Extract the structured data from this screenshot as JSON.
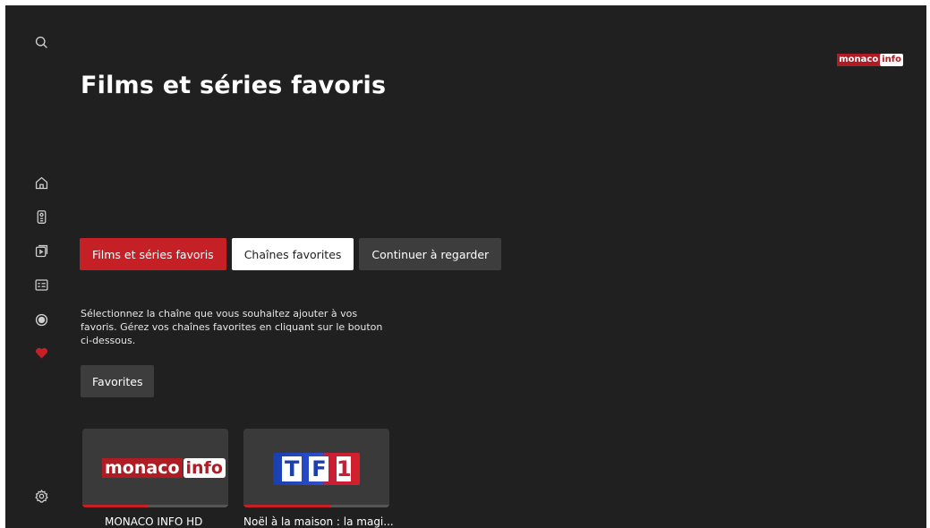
{
  "brand": {
    "logo_left": "monaco",
    "logo_right": "info"
  },
  "sidebar": {
    "items": [
      {
        "icon": "search-icon"
      },
      {
        "icon": "home-icon"
      },
      {
        "icon": "remote-icon"
      },
      {
        "icon": "media-library-icon"
      },
      {
        "icon": "guide-icon"
      },
      {
        "icon": "record-icon"
      },
      {
        "icon": "favorites-heart-icon",
        "active": true
      },
      {
        "icon": "settings-icon"
      }
    ]
  },
  "page": {
    "title": "Films et séries favoris"
  },
  "tabs": [
    {
      "label": "Films et séries favoris",
      "state": "active"
    },
    {
      "label": "Chaînes favorites",
      "state": "focused"
    },
    {
      "label": "Continuer à regarder",
      "state": "default"
    }
  ],
  "description": "Sélectionnez la chaîne que vous souhaitez ajouter à vos favoris. Gérez vos chaînes favorites en cliquant sur le bouton ci-dessous.",
  "favorites_button": {
    "label": "Favorites"
  },
  "cards": [
    {
      "title": "MONACO INFO HD",
      "logo_left": "monaco",
      "logo_right": "info",
      "progress": 0.45
    },
    {
      "title": "Noël à la maison : la magi...",
      "logo": [
        "T",
        "F",
        "1"
      ],
      "progress": 0.6
    }
  ],
  "colors": {
    "accent": "#c62027",
    "background": "#202020",
    "button_dark": "#3d3d3d"
  }
}
